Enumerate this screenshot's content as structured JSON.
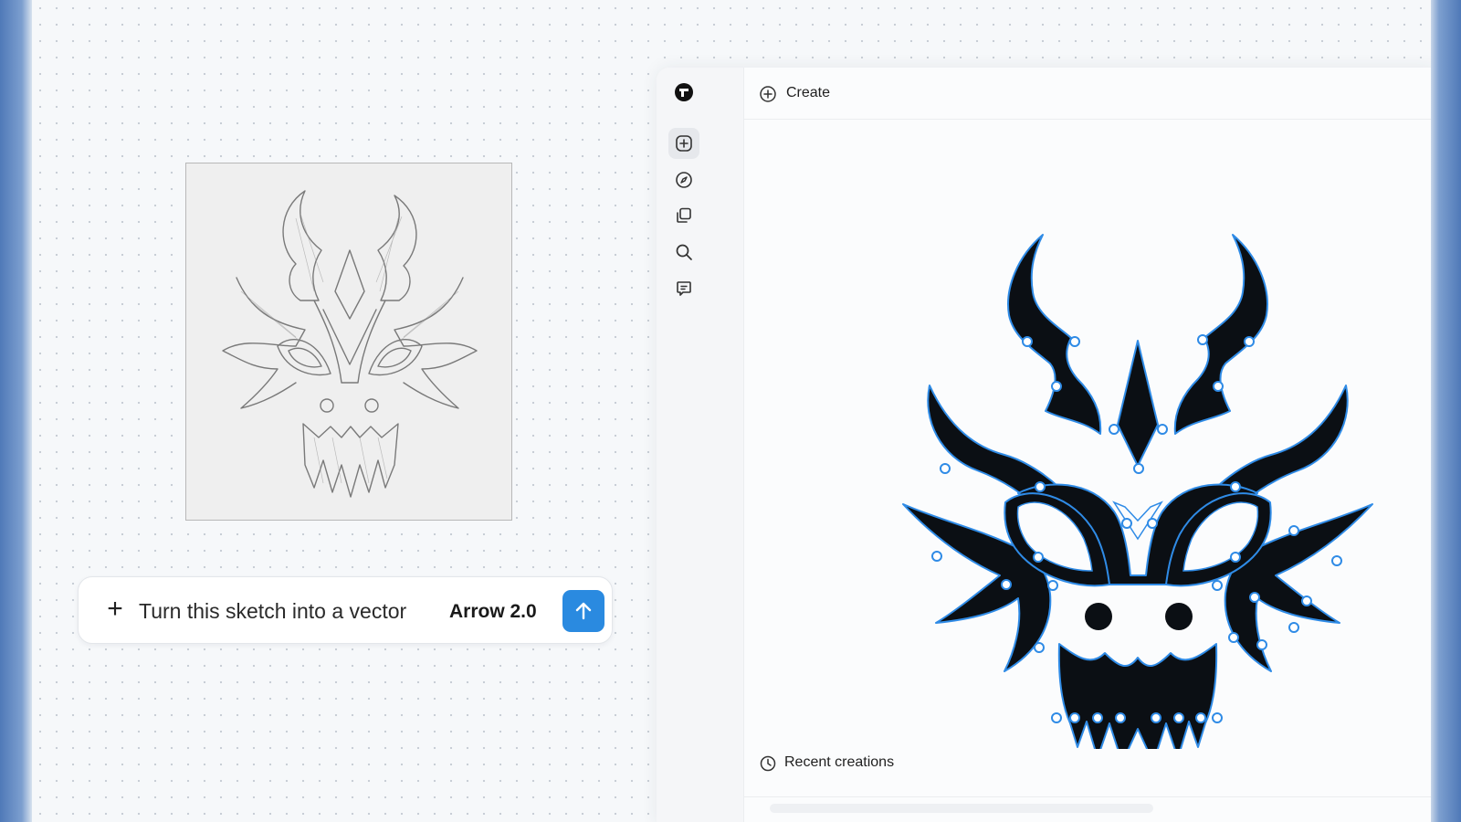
{
  "colors": {
    "accent": "#2a8ae0",
    "vector_fill": "#0b0f14",
    "anchor_stroke": "#2f8be6",
    "canvas_bg": "#f6f8fa"
  },
  "prompt": {
    "add_icon": "plus-icon",
    "text": "Turn this sketch into a vector",
    "model": "Arrow 2.0",
    "send_icon": "arrow-up-icon"
  },
  "sidebar": {
    "logo_icon": "brand-logo-icon",
    "items": [
      {
        "icon": "plus-square-icon",
        "active": true
      },
      {
        "icon": "compass-icon",
        "active": false
      },
      {
        "icon": "copy-icon",
        "active": false
      },
      {
        "icon": "search-icon",
        "active": false
      },
      {
        "icon": "comment-icon",
        "active": false
      }
    ]
  },
  "header": {
    "icon": "plus-circle-icon",
    "title": "Create"
  },
  "recent": {
    "icon": "clock-icon",
    "label": "Recent creations"
  }
}
